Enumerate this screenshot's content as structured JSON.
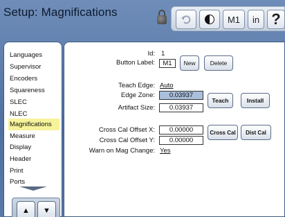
{
  "header": {
    "title": "Setup: Magnifications"
  },
  "toolbar": {
    "undo_icon": "undo-icon",
    "contrast_icon": "contrast-icon",
    "mag_label": "M1",
    "units_label": "in",
    "help_label": "?"
  },
  "menu": {
    "items": [
      {
        "label": "Languages"
      },
      {
        "label": "Supervisor"
      },
      {
        "label": "Encoders"
      },
      {
        "label": "Squareness"
      },
      {
        "label": "SLEC"
      },
      {
        "label": "NLEC"
      },
      {
        "label": "Magnifications"
      },
      {
        "label": "Measure"
      },
      {
        "label": "Display"
      },
      {
        "label": "Header"
      },
      {
        "label": "Print"
      },
      {
        "label": "Ports"
      }
    ],
    "selected": "Magnifications",
    "up_label": "▲",
    "down_label": "▼"
  },
  "form": {
    "id_label": "Id:",
    "id_value": "1",
    "button_label_label": "Button Label:",
    "button_label_value": "M1",
    "new_button": "New",
    "delete_button": "Delete",
    "teach_edge_label": "Teach Edge:",
    "teach_edge_value": "Auto",
    "edge_zone_label": "Edge Zone:",
    "edge_zone_value": "0.03937",
    "artifact_size_label": "Artifact Size:",
    "artifact_size_value": "0.03937",
    "teach_button": "Teach",
    "install_button": "Install",
    "cross_cal_x_label": "Cross Cal Offset X:",
    "cross_cal_x_value": "0.00000",
    "cross_cal_y_label": "Cross Cal Offset Y:",
    "cross_cal_y_value": "0.00000",
    "cross_cal_button": "Cross Cal",
    "dist_cal_button": "Dist Cal",
    "warn_label": "Warn on Mag Change:",
    "warn_value": "Yes"
  },
  "colors": {
    "background": "#5b7ba6",
    "selected_item": "#f6f39a",
    "highlight_field": "#a9bfdb"
  }
}
